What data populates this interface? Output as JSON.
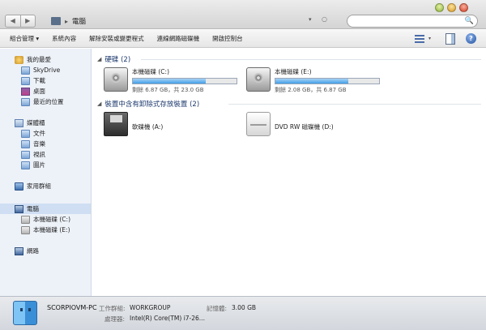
{
  "titlebar": {
    "nav_back": "◀",
    "nav_forward": "▶",
    "breadcrumb_sep": "▸",
    "breadcrumb": "電腦",
    "address_dropdown": "▾",
    "refresh": "○",
    "search_placeholder": "",
    "search_icon": "🔍"
  },
  "toolbar": {
    "items": [
      "組合管理 ▾",
      "系統內容",
      "解除安裝或變更程式",
      "連線網路磁碟機",
      "開啟控制台"
    ],
    "view_dropdown": "▾",
    "help_label": "?"
  },
  "sidebar": {
    "favorites": {
      "label": "我的最愛",
      "icon": "star-icon"
    },
    "favorite_items": [
      {
        "label": "SkyDrive",
        "icon": "folder-icon"
      },
      {
        "label": "下載",
        "icon": "folder-icon"
      },
      {
        "label": "桌面",
        "icon": "desktop-icon"
      },
      {
        "label": "最近的位置",
        "icon": "folder-icon"
      }
    ],
    "libraries": {
      "label": "媒體櫃",
      "icon": "library-icon"
    },
    "library_items": [
      {
        "label": "文件",
        "icon": "folder-icon"
      },
      {
        "label": "音樂",
        "icon": "folder-icon"
      },
      {
        "label": "視訊",
        "icon": "folder-icon"
      },
      {
        "label": "圖片",
        "icon": "folder-icon"
      }
    ],
    "homegroup": {
      "label": "家用群組",
      "icon": "homegroup-icon"
    },
    "computer": {
      "label": "電腦",
      "icon": "computer-icon"
    },
    "computer_items": [
      {
        "label": "本機磁碟 (C:)",
        "icon": "drive-icon"
      },
      {
        "label": "本機磁碟 (E:)",
        "icon": "drive-icon"
      }
    ],
    "network": {
      "label": "網路",
      "icon": "network-icon"
    }
  },
  "content": {
    "hard_disks_header": "硬碟 (2)",
    "removable_header": "裝置中含有卸除式存放裝置 (2)",
    "drives": [
      {
        "name": "本機磁碟 (C:)",
        "capacity": "剩餘 6.87 GB，共 23.0 GB",
        "used_fraction": 0.7,
        "icon": "windows-drive-icon"
      },
      {
        "name": "本機磁碟 (E:)",
        "capacity": "剩餘 2.08 GB，共 6.87 GB",
        "used_fraction": 0.7,
        "icon": "hard-drive-icon"
      }
    ],
    "removable": [
      {
        "name": "軟碟機 (A:)",
        "icon": "floppy-drive-icon"
      },
      {
        "name": "DVD RW 磁碟機 (D:)",
        "icon": "dvd-drive-icon"
      }
    ]
  },
  "details": {
    "computer_name": "SCORPIOVM-PC",
    "workgroup_label": "工作群組:",
    "workgroup_value": "WORKGROUP",
    "memory_label": "記憶體:",
    "memory_value": "3.00 GB",
    "processor_label": "處理器:",
    "processor_value": "Intel(R) Core(TM) i7-26..."
  },
  "colors": {
    "accent": "#1e3a6e",
    "sidebar_bg": "#edf2f9",
    "selection": "#cfdef2",
    "bar_fill": "#43a0e8"
  }
}
